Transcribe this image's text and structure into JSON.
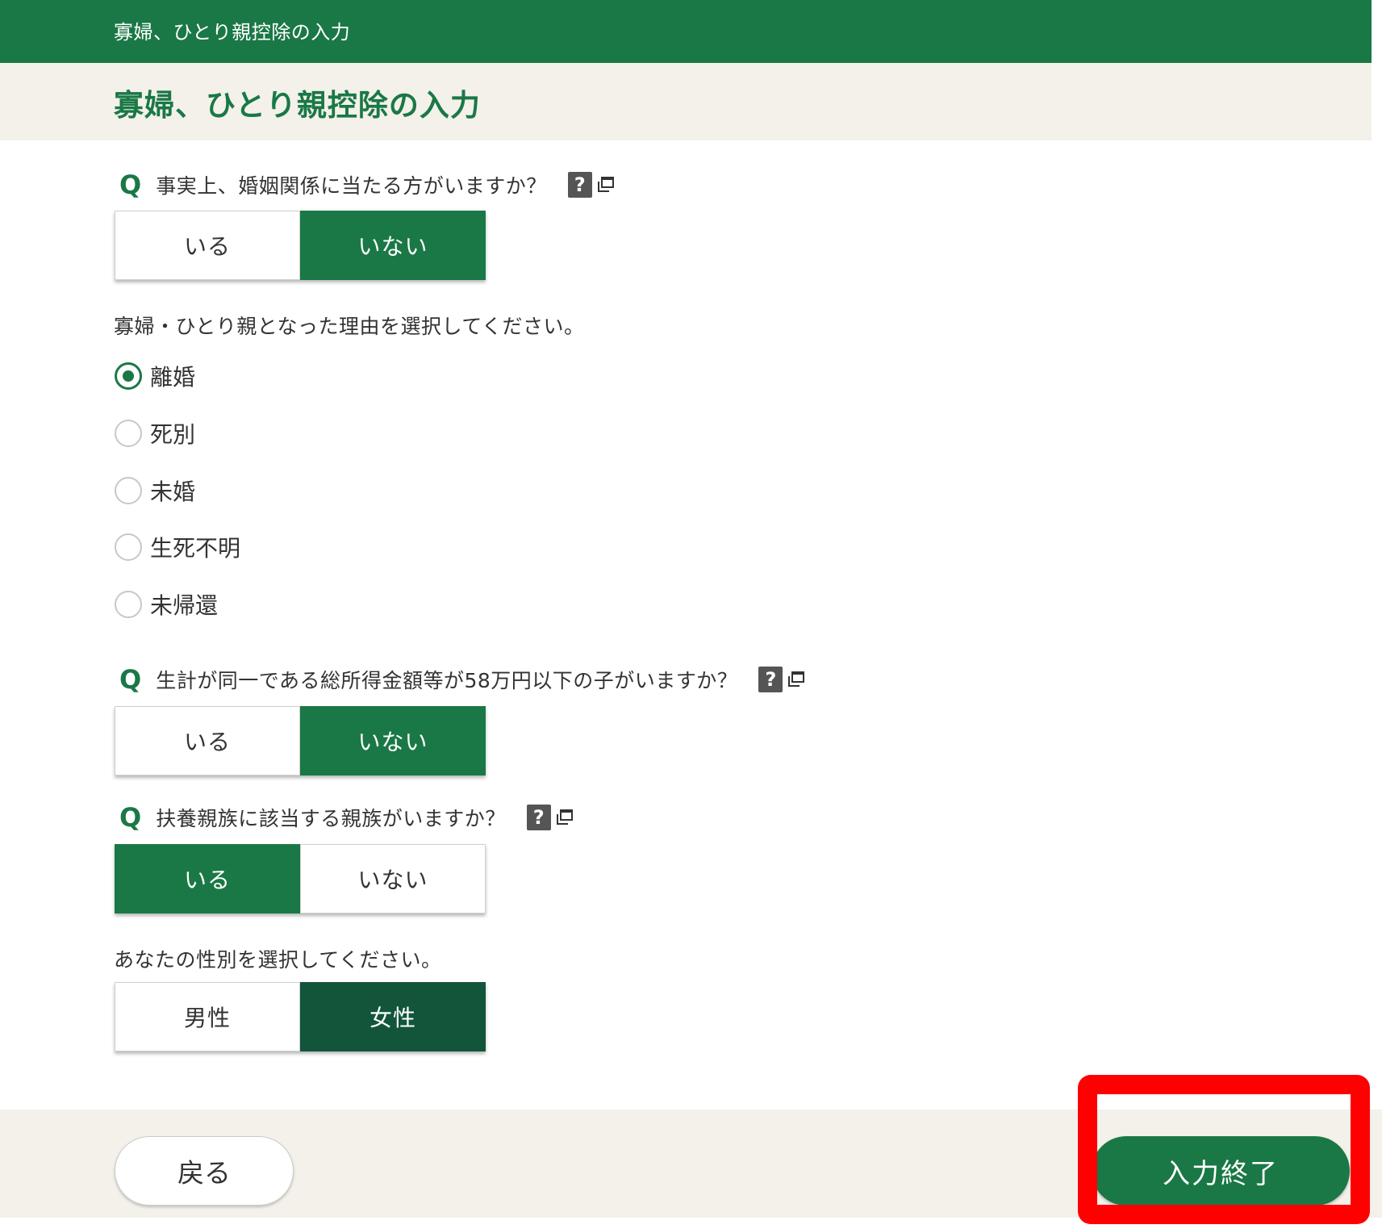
{
  "topbar": {
    "title": "寡婦、ひとり親控除の入力"
  },
  "header": {
    "title": "寡婦、ひとり親控除の入力"
  },
  "q1": {
    "mark": "Q",
    "text": "事実上、婚姻関係に当たる方がいますか？",
    "help": "?",
    "options": [
      "いる",
      "いない"
    ],
    "selected": "いない"
  },
  "reason": {
    "instruction": "寡婦・ひとり親となった理由を選択してください。",
    "options": [
      "離婚",
      "死別",
      "未婚",
      "生死不明",
      "未帰還"
    ],
    "selected": "離婚"
  },
  "q2": {
    "mark": "Q",
    "text": "生計が同一である総所得金額等が58万円以下の子がいますか？",
    "help": "?",
    "options": [
      "いる",
      "いない"
    ],
    "selected": "いない"
  },
  "q3": {
    "mark": "Q",
    "text": "扶養親族に該当する親族がいますか？",
    "help": "?",
    "options": [
      "いる",
      "いない"
    ],
    "selected": "いる"
  },
  "gender": {
    "instruction": "あなたの性別を選択してください。",
    "options": [
      "男性",
      "女性"
    ],
    "selected": "女性"
  },
  "footer": {
    "back_label": "戻る",
    "finish_label": "入力終了"
  },
  "colors": {
    "brand_green": "#1a7846",
    "dark_green": "#12553a",
    "band_beige": "#f3f1ea",
    "highlight_red": "#ff0000"
  },
  "icons": [
    "help-icon",
    "popup-window-icon",
    "radio-icon"
  ]
}
